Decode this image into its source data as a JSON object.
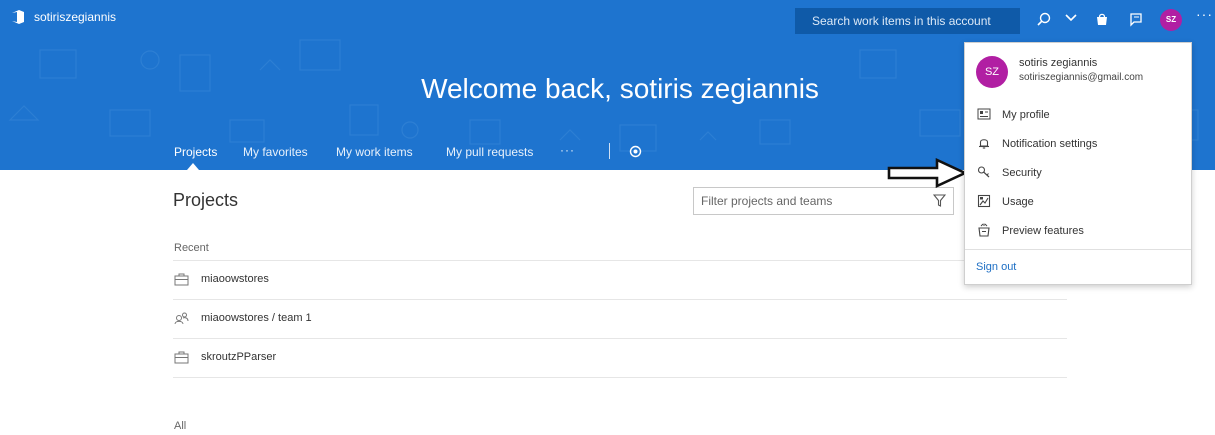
{
  "header": {
    "account": "sotiriszegiannis",
    "search_placeholder": "Search work items in this account",
    "avatar_initials": "SZ",
    "more": "···"
  },
  "hero": {
    "welcome": "Welcome back, sotiris zegiannis"
  },
  "nav": {
    "items": [
      {
        "label": "Projects"
      },
      {
        "label": "My favorites"
      },
      {
        "label": "My work items"
      },
      {
        "label": "My pull requests"
      }
    ],
    "more": "···"
  },
  "main": {
    "title": "Projects",
    "filter_placeholder": "Filter projects and teams",
    "recent_label": "Recent",
    "recent": [
      {
        "name": "miaoowstores",
        "icon": "project-icon"
      },
      {
        "name": "miaoowstores / team 1",
        "icon": "team-icon"
      },
      {
        "name": "skroutzPParser",
        "icon": "project-icon"
      }
    ],
    "all_label": "All"
  },
  "menu": {
    "avatar_initials": "SZ",
    "name": "sotiris zegiannis",
    "email": "sotiriszegiannis@gmail.com",
    "items": [
      {
        "label": "My profile",
        "icon": "profile-card-icon"
      },
      {
        "label": "Notification settings",
        "icon": "bell-icon"
      },
      {
        "label": "Security",
        "icon": "key-icon"
      },
      {
        "label": "Usage",
        "icon": "usage-icon"
      },
      {
        "label": "Preview features",
        "icon": "preview-icon"
      }
    ],
    "sign_out": "Sign out"
  },
  "colors": {
    "header_blue": "#1e74cf",
    "search_blue": "#0f5aa8",
    "avatar_magenta": "#b11fa3",
    "link_blue": "#1e6fc4"
  }
}
